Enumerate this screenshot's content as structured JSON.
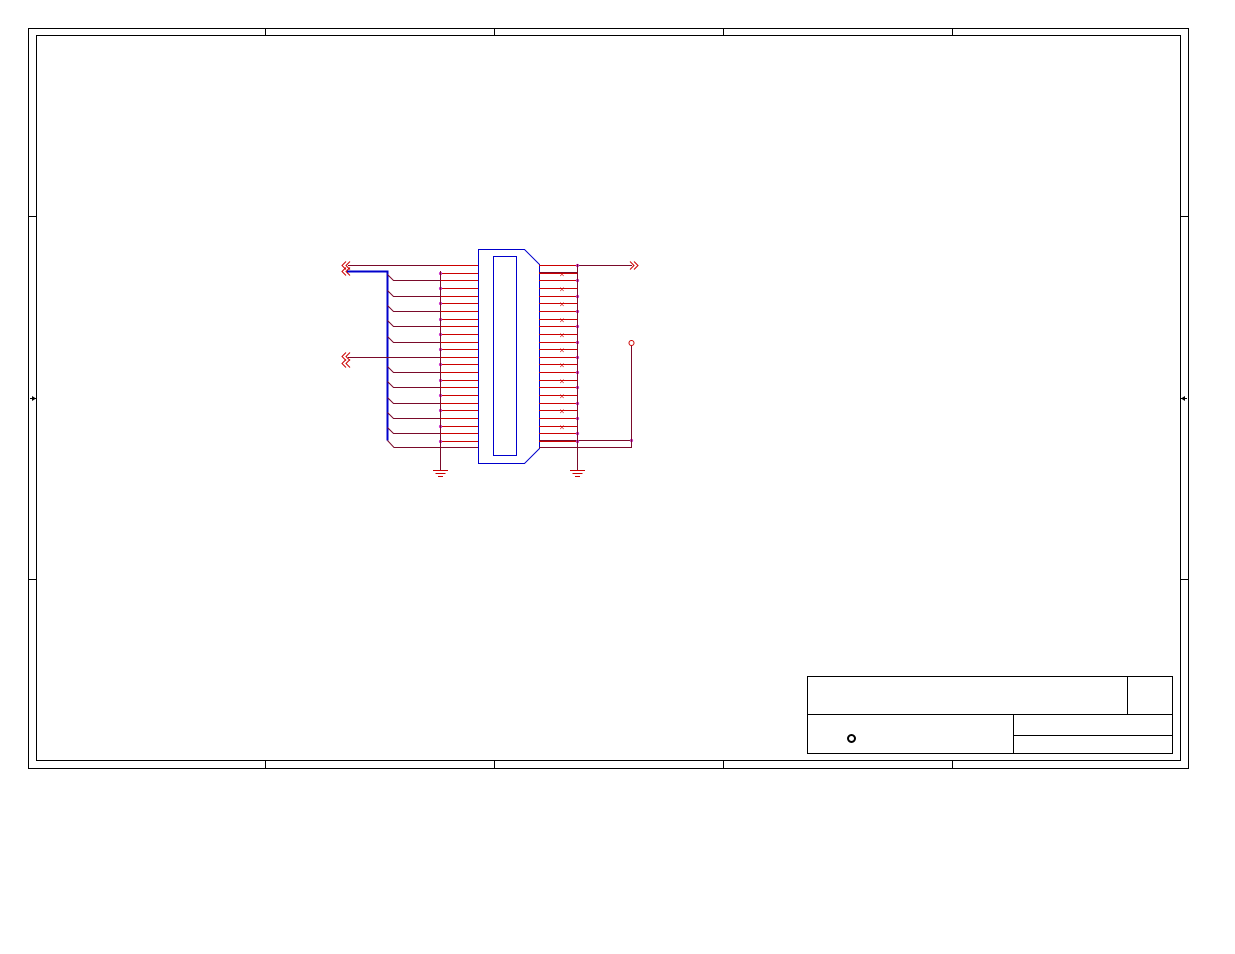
{
  "sheet": {
    "colors": {
      "border": "#000000",
      "wire": "#7a0a2a",
      "bus": "#0000cc",
      "component": "#0000cc",
      "pin": "#cc0000",
      "junction": "#cc33cc",
      "port": "#cc0000",
      "ground": "#cc0000"
    }
  },
  "title_block": {
    "title": "",
    "sheet_number": "",
    "company": "",
    "drawing_number": "",
    "revision": "",
    "logo_icon": "ring-logo-icon"
  },
  "schematic": {
    "component": {
      "name": "ribbon-connector",
      "left_pin_count": 24,
      "right_pin_count": 24
    },
    "left_ports": [
      {
        "name": "port-left-1",
        "icon": "off-sheet-connector-icon"
      },
      {
        "name": "port-left-2",
        "icon": "off-sheet-connector-icon"
      },
      {
        "name": "port-left-3",
        "icon": "off-sheet-connector-icon"
      },
      {
        "name": "port-left-4",
        "icon": "off-sheet-connector-icon"
      }
    ],
    "right_ports": [
      {
        "name": "port-right-1",
        "icon": "off-sheet-connector-icon"
      }
    ],
    "grounds": [
      {
        "name": "ground-left",
        "icon": "ground-icon"
      },
      {
        "name": "ground-right",
        "icon": "ground-icon"
      }
    ]
  }
}
